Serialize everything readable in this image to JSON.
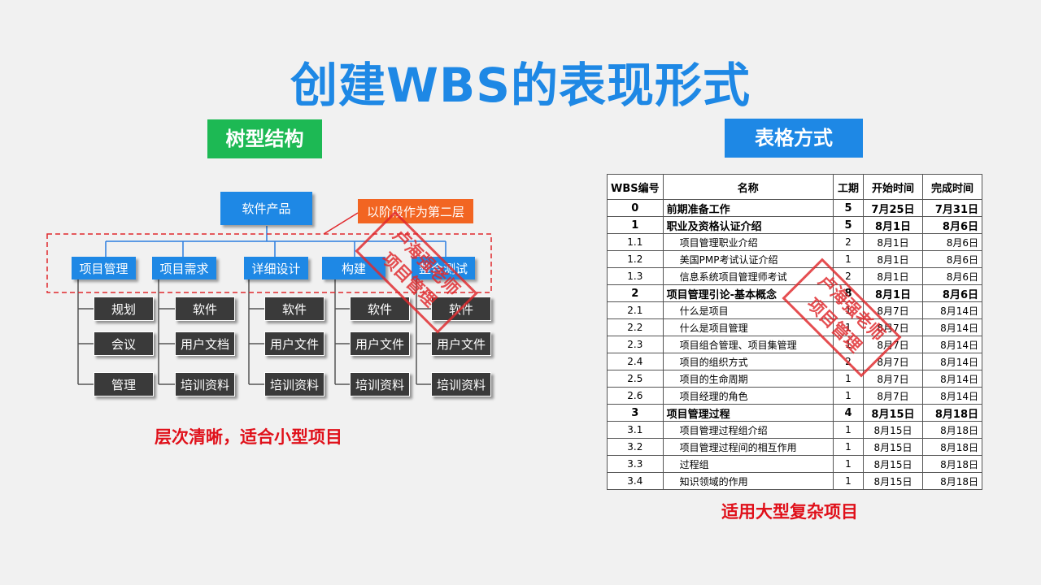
{
  "title": "创建WBS的表现形式",
  "tree_section": {
    "label": "树型结构",
    "root": "软件产品",
    "callout": "以阶段作为第二层",
    "phases": [
      {
        "label": "项目管理",
        "children": [
          "规划",
          "会议",
          "管理"
        ]
      },
      {
        "label": "项目需求",
        "children": [
          "软件",
          "用户文档",
          "培训资料"
        ]
      },
      {
        "label": "详细设计",
        "children": [
          "软件",
          "用户文件",
          "培训资料"
        ]
      },
      {
        "label": "构建",
        "children": [
          "软件",
          "用户文件",
          "培训资料"
        ]
      },
      {
        "label": "整合测试",
        "children": [
          "软件",
          "用户文件",
          "培训资料"
        ]
      }
    ],
    "caption": "层次清晰，适合小型项目",
    "stamp": [
      "卢海强老师",
      "项目管理"
    ]
  },
  "table_section": {
    "label": "表格方式",
    "headers": [
      "WBS编号",
      "名称",
      "工期",
      "开始时间",
      "完成时间"
    ],
    "rows": [
      {
        "code": "0",
        "name": "前期准备工作",
        "duration": "5",
        "start": "7月25日",
        "end": "7月31日",
        "level": 0
      },
      {
        "code": "1",
        "name": "职业及资格认证介绍",
        "duration": "5",
        "start": "8月1日",
        "end": "8月6日",
        "level": 0
      },
      {
        "code": "1.1",
        "name": "项目管理职业介绍",
        "duration": "2",
        "start": "8月1日",
        "end": "8月6日",
        "level": 1
      },
      {
        "code": "1.2",
        "name": "美国PMP考试认证介绍",
        "duration": "1",
        "start": "8月1日",
        "end": "8月6日",
        "level": 1
      },
      {
        "code": "1.3",
        "name": "信息系统项目管理师考试",
        "duration": "2",
        "start": "8月1日",
        "end": "8月6日",
        "level": 1
      },
      {
        "code": "2",
        "name": "项目管理引论-基本概念",
        "duration": "8",
        "start": "8月1日",
        "end": "8月6日",
        "level": 0
      },
      {
        "code": "2.1",
        "name": "什么是项目",
        "duration": "1",
        "start": "8月7日",
        "end": "8月14日",
        "level": 1
      },
      {
        "code": "2.2",
        "name": "什么是项目管理",
        "duration": "1",
        "start": "8月7日",
        "end": "8月14日",
        "level": 1
      },
      {
        "code": "2.3",
        "name": "项目组合管理、项目集管理",
        "duration": "1",
        "start": "8月7日",
        "end": "8月14日",
        "level": 1
      },
      {
        "code": "2.4",
        "name": "项目的组织方式",
        "duration": "2",
        "start": "8月7日",
        "end": "8月14日",
        "level": 1
      },
      {
        "code": "2.5",
        "name": "项目的生命周期",
        "duration": "1",
        "start": "8月7日",
        "end": "8月14日",
        "level": 1
      },
      {
        "code": "2.6",
        "name": "项目经理的角色",
        "duration": "1",
        "start": "8月7日",
        "end": "8月14日",
        "level": 1
      },
      {
        "code": "3",
        "name": "项目管理过程",
        "duration": "4",
        "start": "8月15日",
        "end": "8月18日",
        "level": 0
      },
      {
        "code": "3.1",
        "name": "项目管理过程组介绍",
        "duration": "1",
        "start": "8月15日",
        "end": "8月18日",
        "level": 1
      },
      {
        "code": "3.2",
        "name": "项目管理过程间的相互作用",
        "duration": "1",
        "start": "8月15日",
        "end": "8月18日",
        "level": 1
      },
      {
        "code": "3.3",
        "name": "过程组",
        "duration": "1",
        "start": "8月15日",
        "end": "8月18日",
        "level": 1
      },
      {
        "code": "3.4",
        "name": "知识领域的作用",
        "duration": "1",
        "start": "8月15日",
        "end": "8月18日",
        "level": 1
      }
    ],
    "caption": "适用大型复杂项目",
    "stamp": [
      "卢海强老师",
      "项目管理"
    ]
  },
  "colors": {
    "title": "#1e88e5",
    "tree_badge": "#1db954",
    "table_badge": "#1e88e5",
    "phase_box": "#1e88e5",
    "leaf_box": "#3a3a3a",
    "callout": "#f26522",
    "stamp": "#e0282c",
    "caption": "#e0101a"
  }
}
